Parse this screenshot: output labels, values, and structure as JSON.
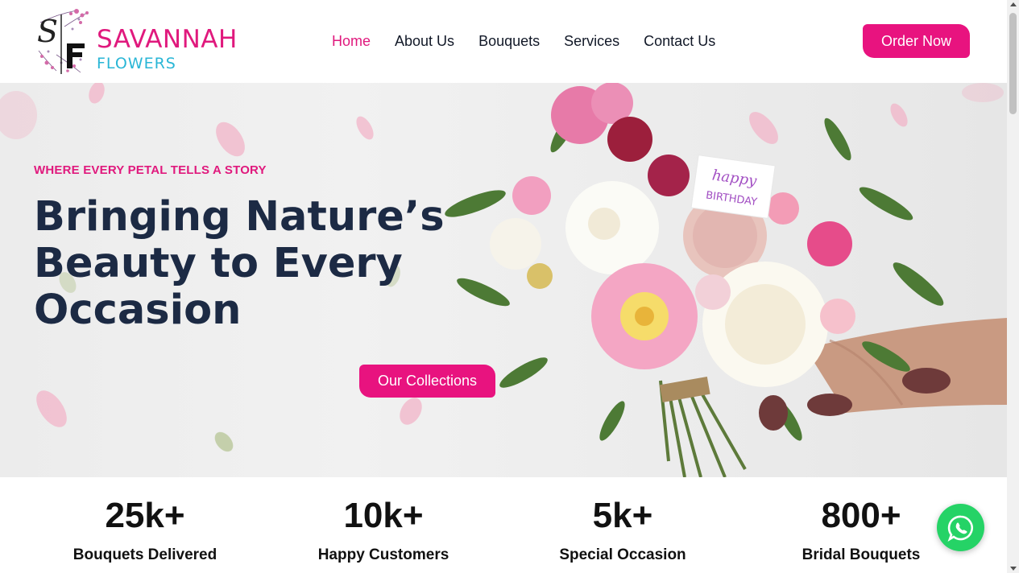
{
  "brand": {
    "logo_mark": "SF",
    "name": "SAVANNAH",
    "sub": "FLOWERS",
    "primary_color": "#e0197d",
    "secondary_color": "#29b6d6"
  },
  "nav": {
    "items": [
      {
        "label": "Home",
        "active": true
      },
      {
        "label": "About Us",
        "active": false
      },
      {
        "label": "Bouquets",
        "active": false
      },
      {
        "label": "Services",
        "active": false
      },
      {
        "label": "Contact Us",
        "active": false
      }
    ],
    "cta": "Order Now"
  },
  "hero": {
    "tagline": "WHERE EVERY PETAL TELLS A STORY",
    "headline_lines": [
      "Bringing Nature’s",
      "Beauty to Every",
      "Occasion"
    ],
    "button": "Our Collections",
    "card_line1": "happy",
    "card_line2": "BIRTHDAY",
    "headline_color": "#1c2a44"
  },
  "stats": [
    {
      "number": "25k+",
      "label": "Bouquets Delivered"
    },
    {
      "number": "10k+",
      "label": "Happy Customers"
    },
    {
      "number": "5k+",
      "label": "Special Occasion"
    },
    {
      "number": "800+",
      "label": "Bridal Bouquets"
    }
  ],
  "floating": {
    "icon": "whatsapp-icon",
    "color": "#25d366"
  }
}
